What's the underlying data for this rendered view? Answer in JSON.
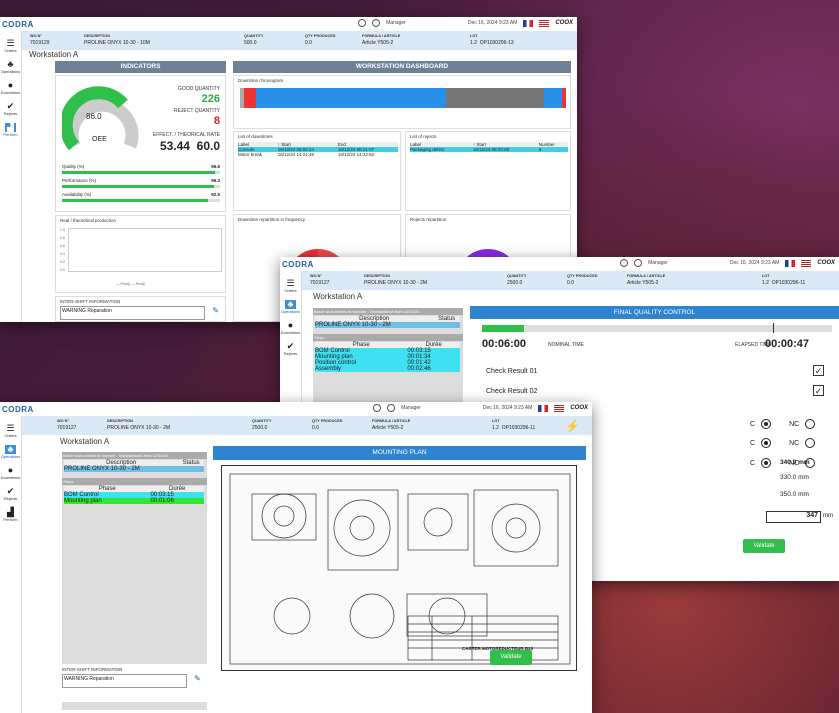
{
  "logo": "CODRA",
  "topbar": {
    "user": "Manager",
    "datetime": "Dec 16, 2024 9:23 AM",
    "brand": "COOX"
  },
  "nav": [
    "Orders",
    "Operations",
    "Downtimes",
    "Rejects",
    "Perform"
  ],
  "hdr_labels": {
    "wo": "WO N°",
    "desc": "DESCRIPTION",
    "qty": "QUANTITY",
    "qtyp": "QTY PRODUCED",
    "formula": "FORMULA / ARTICLE",
    "lot": "LOT"
  },
  "w1": {
    "wo": "7019129",
    "desc": "PROLINE ONYX 10-30 - 10M",
    "qty": "500.0",
    "qtyp": "0.0",
    "formula": "Article Y505-2",
    "lot_a": "1.2",
    "lot_b": "OP1030296-13",
    "workstation": "Workstation A",
    "indicators_title": "INDICATORS",
    "dashboard_title": "WORKSTATION DASHBOARD",
    "gauge_value": "86.0",
    "oee_label": "OEE",
    "good_label": "GOOD QUANTITY",
    "good_value": "226",
    "reject_label": "REJECT QUANTITY",
    "reject_value": "8",
    "rate_label": "EFFECT. / THEORICAL RATE",
    "rate_a": "53.44",
    "rate_b": "60.0",
    "bars": [
      {
        "label": "Quality (%)",
        "value": "96.6",
        "pct": 96.6
      },
      {
        "label": "Performance (%)",
        "value": "96.3",
        "pct": 96.3
      },
      {
        "label": "Availability (%)",
        "value": "92.5",
        "pct": 92.5
      }
    ],
    "real_title": "Real / theoretical production",
    "yticks": [
      "1.0",
      "0.8",
      "0.6",
      "0.4",
      "0.2",
      "0.0"
    ],
    "chart_legend": "— Prod() — Prod()",
    "inter_title": "INTER-SHIFT INFORMATION",
    "inter_text": "WARNING Reparation",
    "chrono_title": "Downtime chronogram",
    "downtimes_title": "List of downtimes",
    "dt_cols": [
      "Label",
      "↑ Start",
      "End"
    ],
    "dt_rows": [
      [
        "Console",
        "16/12/24 08:02:24",
        "16/12/24 08:21:07"
      ],
      [
        "Motor break",
        "16/12/24 14:21:46",
        "16/12/24 14:22:52"
      ]
    ],
    "rejects_title": "List of rejects",
    "rj_cols": [
      "Label",
      "↑ Start",
      "Number"
    ],
    "rj_rows": [
      [
        "Packaging defect",
        "16/12/24 08:20:00",
        "8"
      ]
    ],
    "dt_freq_title": "Downtime repartition in frequency",
    "rj_rep_title": "Rejects repartition"
  },
  "w2": {
    "wo": "7019127",
    "desc": "PROLINE ONYX 10-30 - 2M",
    "qty": "2500.0",
    "qtyp": "0.0",
    "formula": "Article Y505-2",
    "lot_a": "1.2",
    "lot_b": "OP1030296-11",
    "workstation": "Workstation A",
    "batch_title": "Batch work entries to execute - WorkstationA from 12/16/24",
    "batch_cols": [
      "Description",
      "Status"
    ],
    "batch_desc": "PROLINE ONYX 10-30 - 2M",
    "steps_label": "Steps",
    "steps_cols": [
      "Phase",
      "Durée"
    ],
    "steps": [
      [
        "BOM Control",
        "00:03:15"
      ],
      [
        "Mounting plan",
        "00:01:34"
      ],
      [
        "Position control",
        "00:01:42"
      ],
      [
        "Assembly",
        "00:02:46"
      ]
    ],
    "fqc_title": "FINAL QUALITY CONTROL",
    "nominal": "00:06:00",
    "nominal_label": "NOMINAL TIME",
    "elapsed_label": "ELAPSED TIME",
    "elapsed": "00:00:47",
    "checks": [
      "Check Result 01",
      "Check Result 02"
    ],
    "cnc": [
      {
        "c": "C",
        "nc": "NC"
      },
      {
        "c": "C",
        "nc": "NC"
      },
      {
        "c": "C",
        "nc": "NC"
      }
    ],
    "measures": [
      "340.0",
      "330.0",
      "350.0"
    ],
    "input_value": "347",
    "unit": "mm",
    "validate": "Validate"
  },
  "w3": {
    "wo": "7019127",
    "desc": "PROLINE ONYX 10-30 - 2M",
    "qty": "2500.0",
    "qtyp": "0.0",
    "formula": "Article Y505-2",
    "lot_a": "1.2",
    "lot_b": "OP1030296-11",
    "workstation": "Workstation A",
    "batch_title": "Batch work entries to execute - WorkstationA from 12/16/24",
    "batch_cols": [
      "Description",
      "Status"
    ],
    "batch_desc": "PROLINE ONYX 10-30 - 2M",
    "steps_label": "Steps",
    "steps_cols": [
      "Phase",
      "Durée"
    ],
    "steps": [
      [
        "BOM Control",
        "00:03:15"
      ],
      [
        "Mounting plan",
        "00:01:06"
      ]
    ],
    "mounting_title": "MOUNTING PLAN",
    "drawing_title": "CARTER MOTOREDUCTEUR B20",
    "inter_title": "INTER-SHIFT INFORMATION",
    "inter_text": "WARNING Reparation",
    "validate": "Validate"
  },
  "colors": {
    "accent": "#2f84d0",
    "green": "#2ea84a",
    "red": "#dd2222",
    "cyan": "#3fd0e8"
  }
}
